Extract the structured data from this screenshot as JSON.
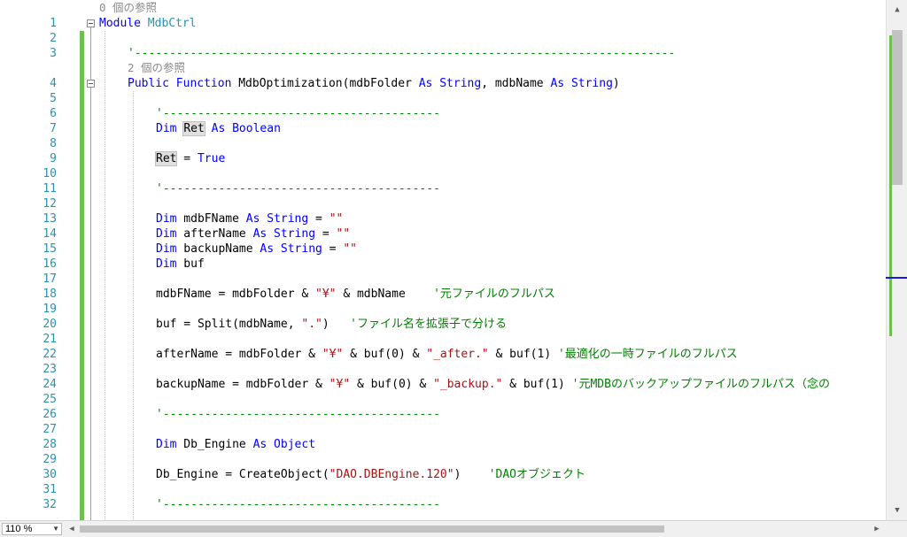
{
  "editor": {
    "references": {
      "module_refs": "0 個の参照",
      "function_refs": "2 個の参照"
    },
    "line_numbers": [
      "1",
      "2",
      "3",
      "4",
      "5",
      "6",
      "7",
      "8",
      "9",
      "10",
      "11",
      "12",
      "13",
      "14",
      "15",
      "16",
      "17",
      "18",
      "19",
      "20",
      "21",
      "22",
      "23",
      "24",
      "25",
      "26",
      "27",
      "28",
      "29",
      "30",
      "31",
      "32"
    ],
    "lines": {
      "l1_kw": "Module",
      "l1_name": " MdbCtrl",
      "l3_sep": "'------------------------------------------------------------------------------",
      "l4_kw1": "Public Function",
      "l4_name": " MdbOptimization(mdbFolder ",
      "l4_kw2": "As String",
      "l4_mid": ", mdbName ",
      "l4_kw3": "As String",
      "l4_end": ")",
      "l6_sep": "'----------------------------------------",
      "l7_kw1": "Dim",
      "l7_var": "Ret",
      "l7_kw2": " As Boolean",
      "l9_var": "Ret",
      "l9_eq": " = ",
      "l9_kw": "True",
      "l11_sep": "'----------------------------------------",
      "l13_kw1": "Dim",
      "l13_var": " mdbFName ",
      "l13_kw2": "As String",
      "l13_eq": " = ",
      "l13_str": "\"\"",
      "l14_kw1": "Dim",
      "l14_var": " afterName ",
      "l14_kw2": "As String",
      "l14_eq": " = ",
      "l14_str": "\"\"",
      "l15_kw1": "Dim",
      "l15_var": " backupName ",
      "l15_kw2": "As String",
      "l15_eq": " = ",
      "l15_str": "\"\"",
      "l16_kw": "Dim",
      "l16_var": " buf",
      "l18_code1": "mdbFName = mdbFolder & ",
      "l18_str": "\"¥\"",
      "l18_code2": " & mdbName    ",
      "l18_cm": "'元ファイルのフルパス",
      "l20_code1": "buf = Split(mdbName, ",
      "l20_str": "\".\"",
      "l20_code2": ")   ",
      "l20_cm": "'ファイル名を拡張子で分ける",
      "l22_code1": "afterName = mdbFolder & ",
      "l22_str1": "\"¥\"",
      "l22_code2": " & buf(0) & ",
      "l22_str2": "\"_after.\"",
      "l22_code3": " & buf(1) ",
      "l22_cm": "'最適化の一時ファイルのフルパス",
      "l24_code1": "backupName = mdbFolder & ",
      "l24_str1": "\"¥\"",
      "l24_code2": " & buf(0) & ",
      "l24_str2": "\"_backup.\"",
      "l24_code3": " & buf(1) ",
      "l24_cm": "'元MDBのバックアップファイルのフルパス（念の",
      "l26_sep": "'----------------------------------------",
      "l28_kw1": "Dim",
      "l28_var": " Db_Engine ",
      "l28_kw2": "As Object",
      "l30_code1": "Db_Engine = CreateObject(",
      "l30_str": "\"DAO.DBEngine.120\"",
      "l30_code2": ")    ",
      "l30_cm": "'DAOオブジェクト",
      "l32_sep": "'----------------------------------------"
    }
  },
  "status": {
    "zoom": "110 %"
  },
  "colors": {
    "keyword": "#0000ff",
    "comment": "#008000",
    "string": "#a31515",
    "line_number": "#2b91af",
    "change_bar": "#6cc24a"
  },
  "icons": {
    "scroll_up": "▲",
    "scroll_down": "▼",
    "scroll_left": "◀",
    "scroll_right": "▶",
    "dropdown": "▼"
  }
}
